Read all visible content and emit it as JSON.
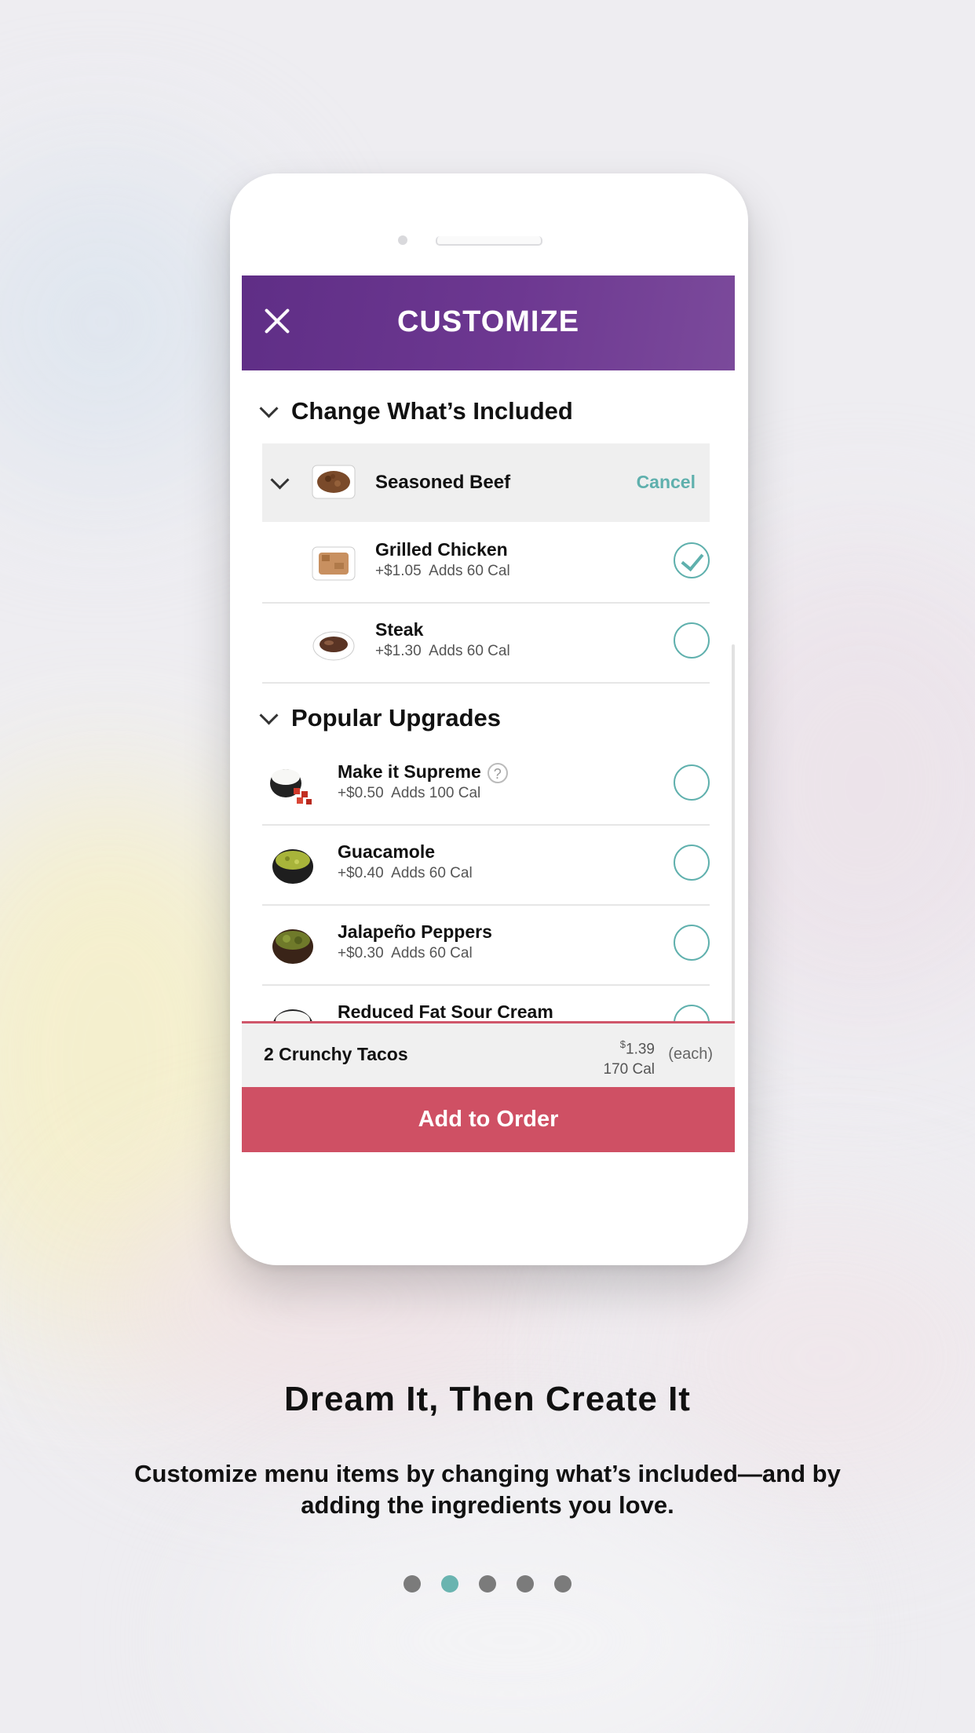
{
  "header": {
    "title": "CUSTOMIZE"
  },
  "sections": {
    "included_title": "Change What’s Included",
    "selected": {
      "name": "Seasoned Beef",
      "action": "Cancel"
    },
    "options": [
      {
        "name": "Grilled Chicken",
        "price": "+$1.05",
        "cal": "Adds 60 Cal",
        "checked": true
      },
      {
        "name": "Steak",
        "price": "+$1.30",
        "cal": "Adds 60 Cal",
        "checked": false
      }
    ],
    "upgrades_title": "Popular Upgrades",
    "upgrades": [
      {
        "name": "Make it Supreme",
        "price": "+$0.50",
        "cal": "Adds 100 Cal",
        "help": "?"
      },
      {
        "name": "Guacamole",
        "price": "+$0.40",
        "cal": "Adds 60 Cal"
      },
      {
        "name": "Jalapeño Peppers",
        "price": "+$0.30",
        "cal": "Adds 60 Cal"
      },
      {
        "name": "Reduced Fat Sour Cream"
      }
    ]
  },
  "summary": {
    "qty_item": "2  Crunchy Tacos",
    "price_symbol": "$",
    "price": "1.39",
    "cal": "170 Cal",
    "each": "(each)"
  },
  "add_button": "Add to Order",
  "onboarding": {
    "headline": "Dream It, Then Create It",
    "description": "Customize menu items by changing what’s included—and by adding the ingredients you love.",
    "page_count": 5,
    "active_page": 2
  },
  "colors": {
    "header": "#6a3590",
    "accent": "#5fb0ad",
    "button": "#cf5064"
  }
}
